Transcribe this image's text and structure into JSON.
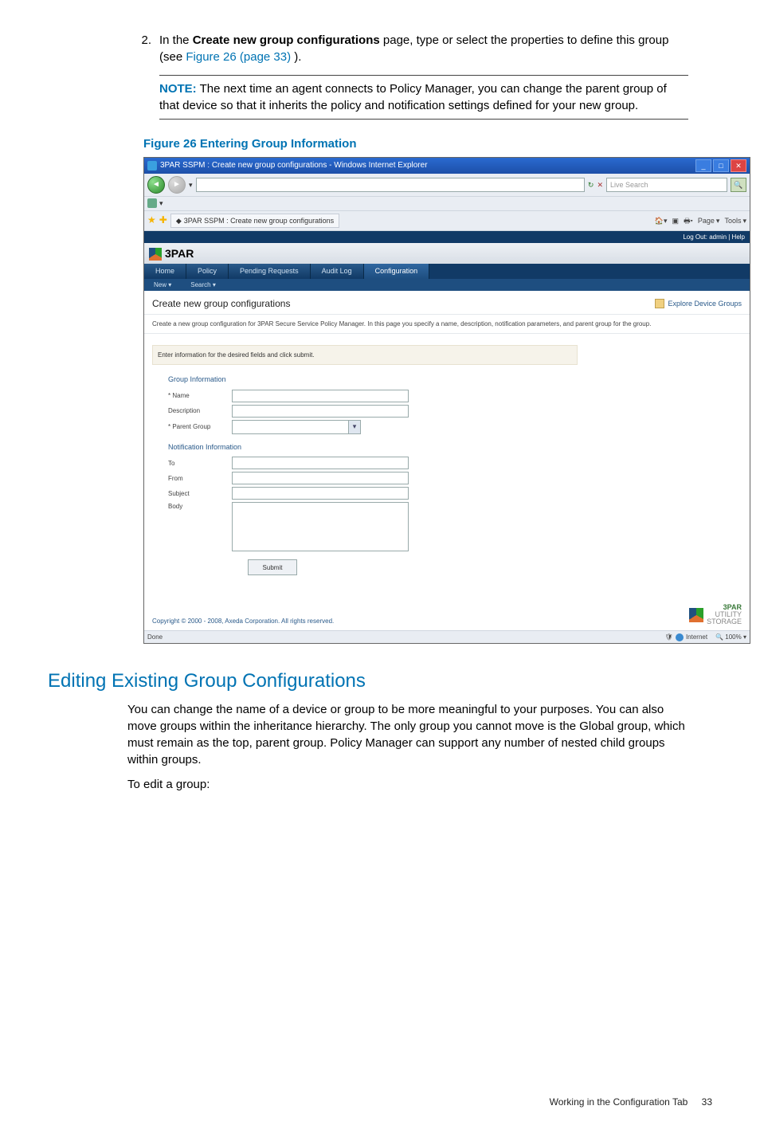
{
  "step": {
    "num": "2.",
    "pre": "In the ",
    "bold": "Create new group configurations",
    "post": " page, type or select the properties to define this group (see ",
    "link": "Figure 26 (page 33)",
    "tail": ")."
  },
  "note": {
    "label": "NOTE:",
    "text": "The next time an agent connects to Policy Manager, you can change the parent group of that device so that it inherits the policy and notification settings defined for your new group."
  },
  "figcap": "Figure 26 Entering Group Information",
  "win": {
    "title": "3PAR SSPM : Create new group configurations - Windows Internet Explorer",
    "search_placeholder": "Live Search",
    "tab_label": "3PAR SSPM : Create new group configurations",
    "tools": {
      "page": "Page",
      "tools": "Tools"
    },
    "userlinks": "Log Out: admin   |   Help",
    "tabs": {
      "home": "Home",
      "policy": "Policy",
      "pending": "Pending Requests",
      "audit": "Audit Log",
      "config": "Configuration"
    },
    "sub": {
      "new": "New ▾",
      "search": "Search ▾"
    },
    "page_title": "Create new group configurations",
    "explore": "Explore Device Groups",
    "desc": "Create a new group configuration for 3PAR Secure Service Policy Manager. In this page you specify a name, description, notification parameters, and parent group for the group.",
    "instr": "Enter information for the desired fields and click submit.",
    "grp_info": "Group Information",
    "lbl_name": "* Name",
    "lbl_desc": "Description",
    "lbl_parent": "* Parent Group",
    "notif_info": "Notification Information",
    "lbl_to": "To",
    "lbl_from": "From",
    "lbl_subject": "Subject",
    "lbl_body": "Body",
    "submit": "Submit",
    "copyright": "Copyright © 2000 - 2008, Axeda Corporation. All rights reserved.",
    "brand": "3PAR",
    "brand_sub1": "UTILITY",
    "brand_sub2": "STORAGE",
    "status_done": "Done",
    "status_zone": "Internet",
    "status_zoom": "100%"
  },
  "section_title": "Editing Existing Group Configurations",
  "para1": "You can change the name of a device or group to be more meaningful to your purposes. You can also move groups within the inheritance hierarchy. The only group you cannot move is the Global group, which must remain as the top, parent group. Policy Manager can support any number of nested child groups within groups.",
  "para2": "To edit a group:",
  "footer": {
    "text": "Working in the Configuration Tab",
    "page": "33"
  }
}
